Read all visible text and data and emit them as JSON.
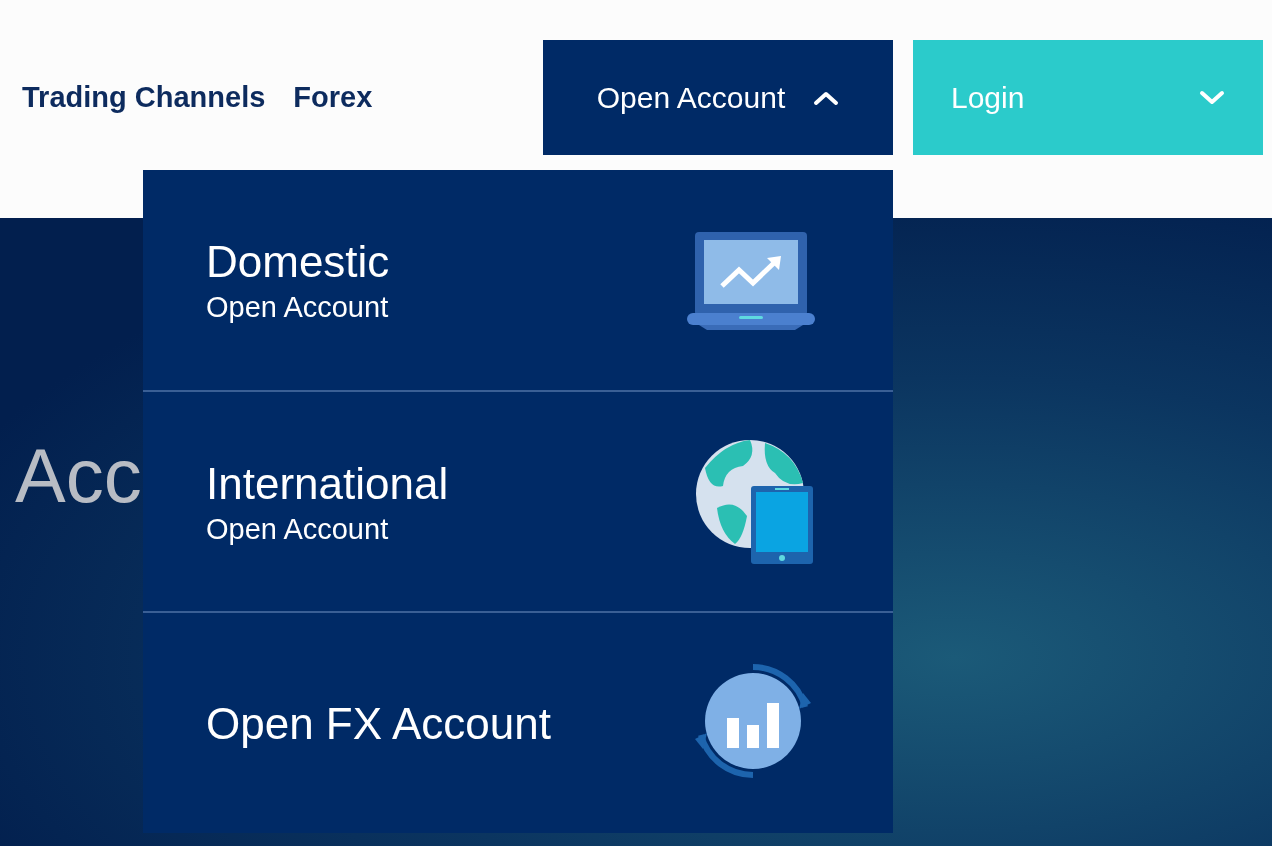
{
  "nav": {
    "links": [
      "Trading Channels",
      "Forex"
    ]
  },
  "open_account_menu": {
    "label": "Open Account",
    "expanded": true,
    "items": [
      {
        "title": "Domestic",
        "subtitle": "Open Account"
      },
      {
        "title": "International",
        "subtitle": "Open Account"
      },
      {
        "title": "Open FX Account"
      }
    ]
  },
  "login_menu": {
    "label": "Login",
    "expanded": false
  },
  "hero": {
    "heading": "Acc"
  }
}
